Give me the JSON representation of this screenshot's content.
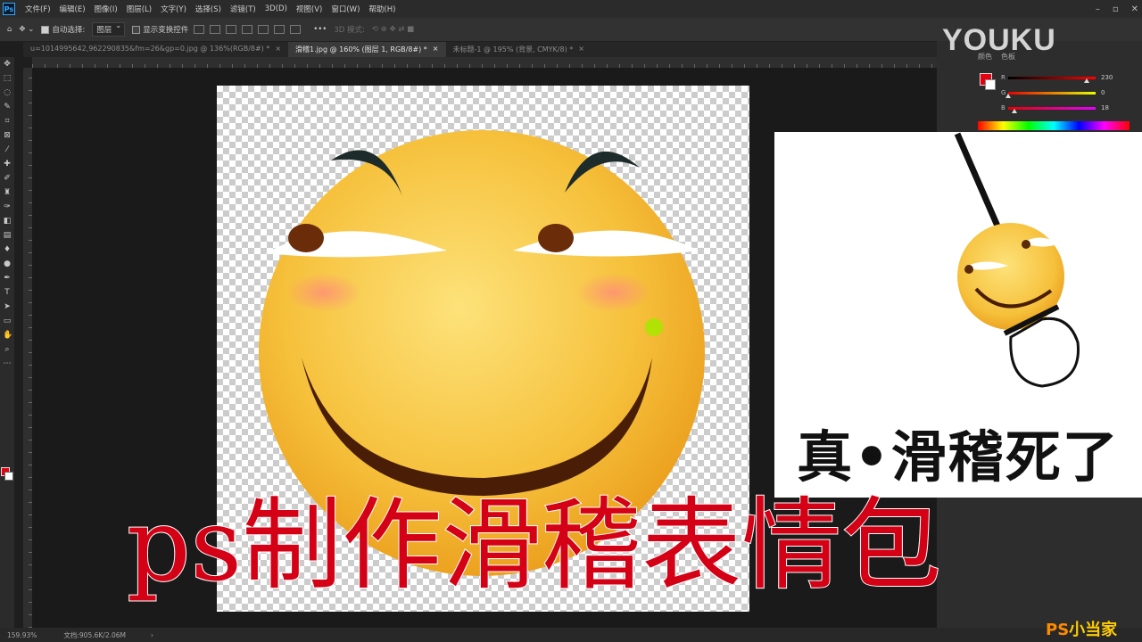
{
  "app": {
    "logo": "Ps"
  },
  "menu": [
    "文件(F)",
    "编辑(E)",
    "图像(I)",
    "图层(L)",
    "文字(Y)",
    "选择(S)",
    "滤镜(T)",
    "3D(D)",
    "视图(V)",
    "窗口(W)",
    "帮助(H)"
  ],
  "options": {
    "auto_select_label": "自动选择:",
    "auto_select_value": "图层",
    "show_transform_label": "显示变换控件",
    "mode_3d_label": "3D 模式:"
  },
  "tabs": [
    {
      "label": "u=1014995642,962290835&fm=26&gp=0.jpg @ 136%(RGB/8#) *",
      "close": "×"
    },
    {
      "label": "滑稽1.jpg @ 160% (图层 1, RGB/8#) *",
      "close": "×"
    },
    {
      "label": "未标题-1 @ 195% (背景, CMYK/8) *",
      "close": "×"
    }
  ],
  "panel": {
    "tabs": [
      "颜色",
      "色板"
    ],
    "sliders": [
      {
        "label": "R",
        "value": "230",
        "level": 0.9,
        "gradient": "linear-gradient(90deg,#000,#f00)"
      },
      {
        "label": "G",
        "value": "0",
        "level": 0.0,
        "gradient": "linear-gradient(90deg,#e60000,#e6ff00)"
      },
      {
        "label": "B",
        "value": "18",
        "level": 0.07,
        "gradient": "linear-gradient(90deg,#e60000,#e600ff)"
      }
    ],
    "foreground": "#e6000f"
  },
  "watermark_brand": "YOUKU",
  "card": {
    "caption": "真•滑稽死了"
  },
  "caption": "ps制作滑稽表情包",
  "status": {
    "zoom": "159.93%",
    "doc": "文档:905.6K/2.06M",
    "arrow": "›"
  },
  "channel_logo": {
    "ps": "PS",
    "rest": "小当家"
  }
}
